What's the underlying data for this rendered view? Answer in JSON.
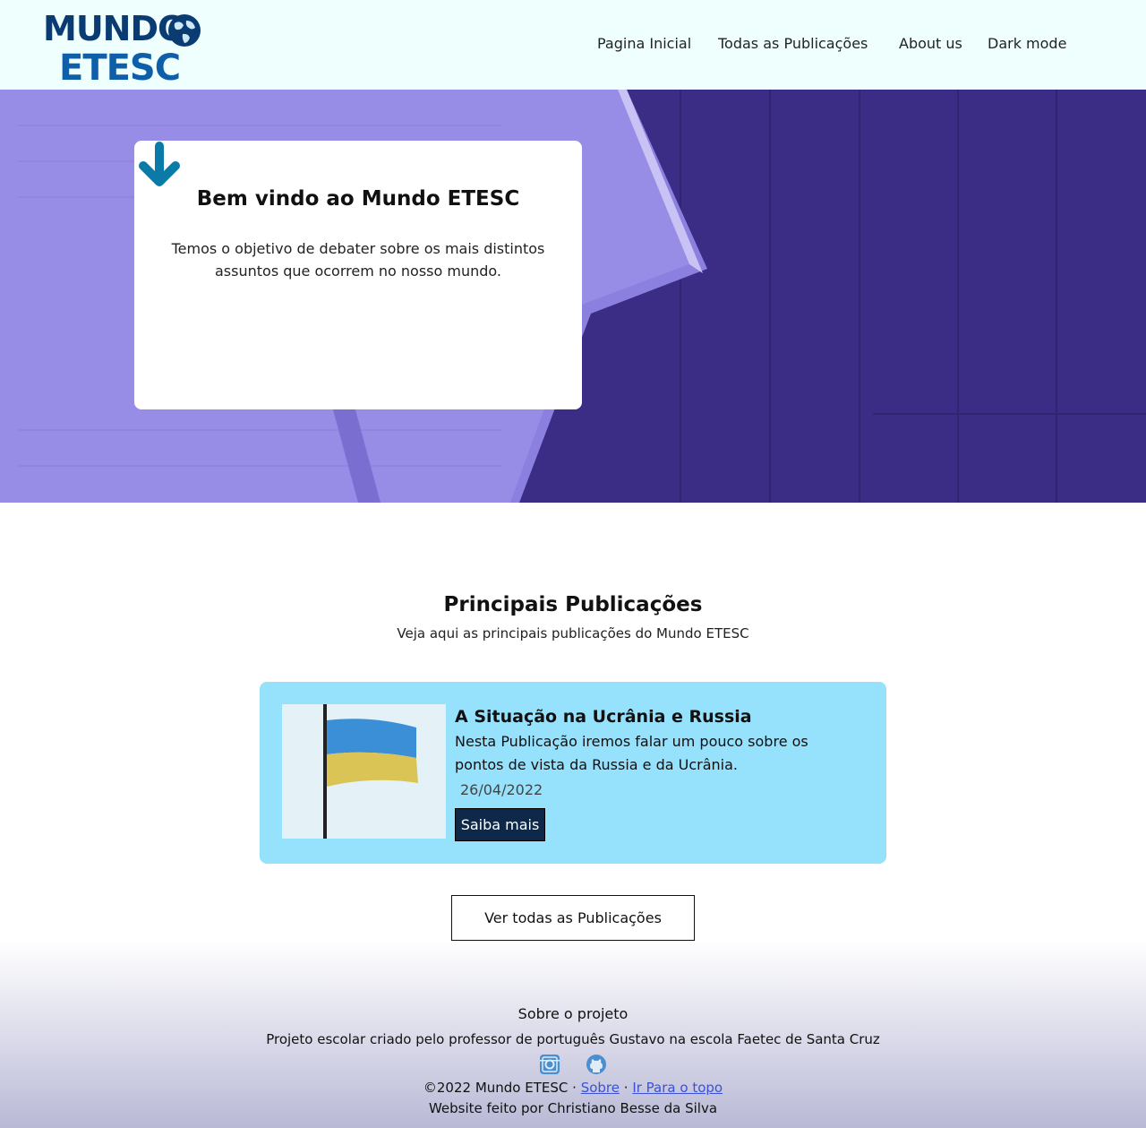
{
  "header": {
    "logo_line1": "MUNDO",
    "logo_line2": "ETESC",
    "nav": [
      "Pagina Inicial",
      "Todas as Publicações",
      "About us",
      "Dark mode"
    ]
  },
  "hero": {
    "title": "Bem vindo ao Mundo ETESC",
    "text": "Temos o objetivo de debater sobre os mais distintos assuntos que ocorrem no nosso mundo."
  },
  "section": {
    "title": "Principais Publicações",
    "subtitle": "Veja aqui as principais publicações do Mundo ETESC"
  },
  "post": {
    "title": "A Situação na Ucrânia e Russia",
    "description": "Nesta Publicação iremos falar um pouco sobre os pontos de vista da Russia e da Ucrânia.",
    "date": "26/04/2022",
    "button": "Saiba mais"
  },
  "all_button": "Ver todas as Publicações",
  "footer": {
    "about_title": "Sobre o projeto",
    "about_text": "Projeto escolar criado pelo professor de português Gustavo na escola Faetec de Santa Cruz",
    "copyright": "©2022 Mundo ETESC ·",
    "link_sobre": "Sobre",
    "sep": "·",
    "link_top": "Ir Para o topo",
    "credit": "Website feito por Christiano Besse da Silva"
  },
  "colors": {
    "header_bg": "#effffd",
    "hero_overlay": "#3c2c86",
    "post_bg": "#96e1fc",
    "button_dark": "#0d2848",
    "arrow": "#0a7aa8",
    "link": "#3a52d8"
  },
  "icons": [
    "globe-icon",
    "arrow-down-icon",
    "instagram-icon",
    "github-icon"
  ]
}
